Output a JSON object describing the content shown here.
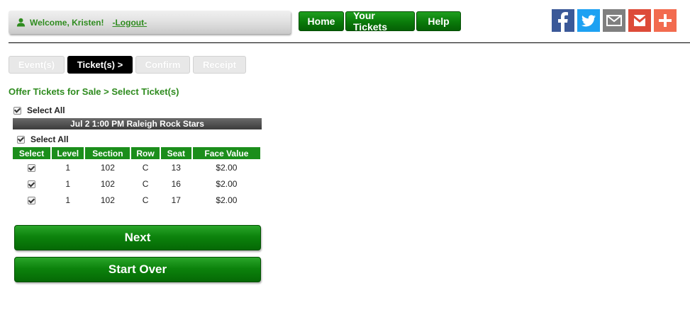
{
  "header": {
    "welcome_text": "Welcome, Kristen!",
    "logout_label": "-Logout-"
  },
  "nav": {
    "home": "Home",
    "your_tickets": "Your Tickets",
    "help": "Help"
  },
  "social_icons": [
    "facebook-icon",
    "twitter-icon",
    "email-icon",
    "gmail-icon",
    "plus-share-icon"
  ],
  "steps": {
    "events": "Event(s)",
    "tickets": "Ticket(s) >",
    "confirm": "Confirm",
    "receipt": "Receipt"
  },
  "page_title": "Offer Tickets for Sale > Select Ticket(s)",
  "select_all_label": "Select All",
  "event": {
    "label": "Jul 2 1:00 PM  Raleigh Rock Stars"
  },
  "table": {
    "headers": [
      "Select",
      "Level",
      "Section",
      "Row",
      "Seat",
      "Face Value"
    ],
    "rows": [
      {
        "checked": true,
        "level": "1",
        "section": "102",
        "row": "C",
        "seat": "13",
        "face_value": "$2.00"
      },
      {
        "checked": true,
        "level": "1",
        "section": "102",
        "row": "C",
        "seat": "16",
        "face_value": "$2.00"
      },
      {
        "checked": true,
        "level": "1",
        "section": "102",
        "row": "C",
        "seat": "17",
        "face_value": "$2.00"
      }
    ]
  },
  "buttons": {
    "next": "Next",
    "start_over": "Start Over"
  },
  "colors": {
    "brand_green": "#2e8b1e",
    "button_green": "#0c830c",
    "facebook": "#3b5998",
    "twitter": "#1da1f2"
  }
}
